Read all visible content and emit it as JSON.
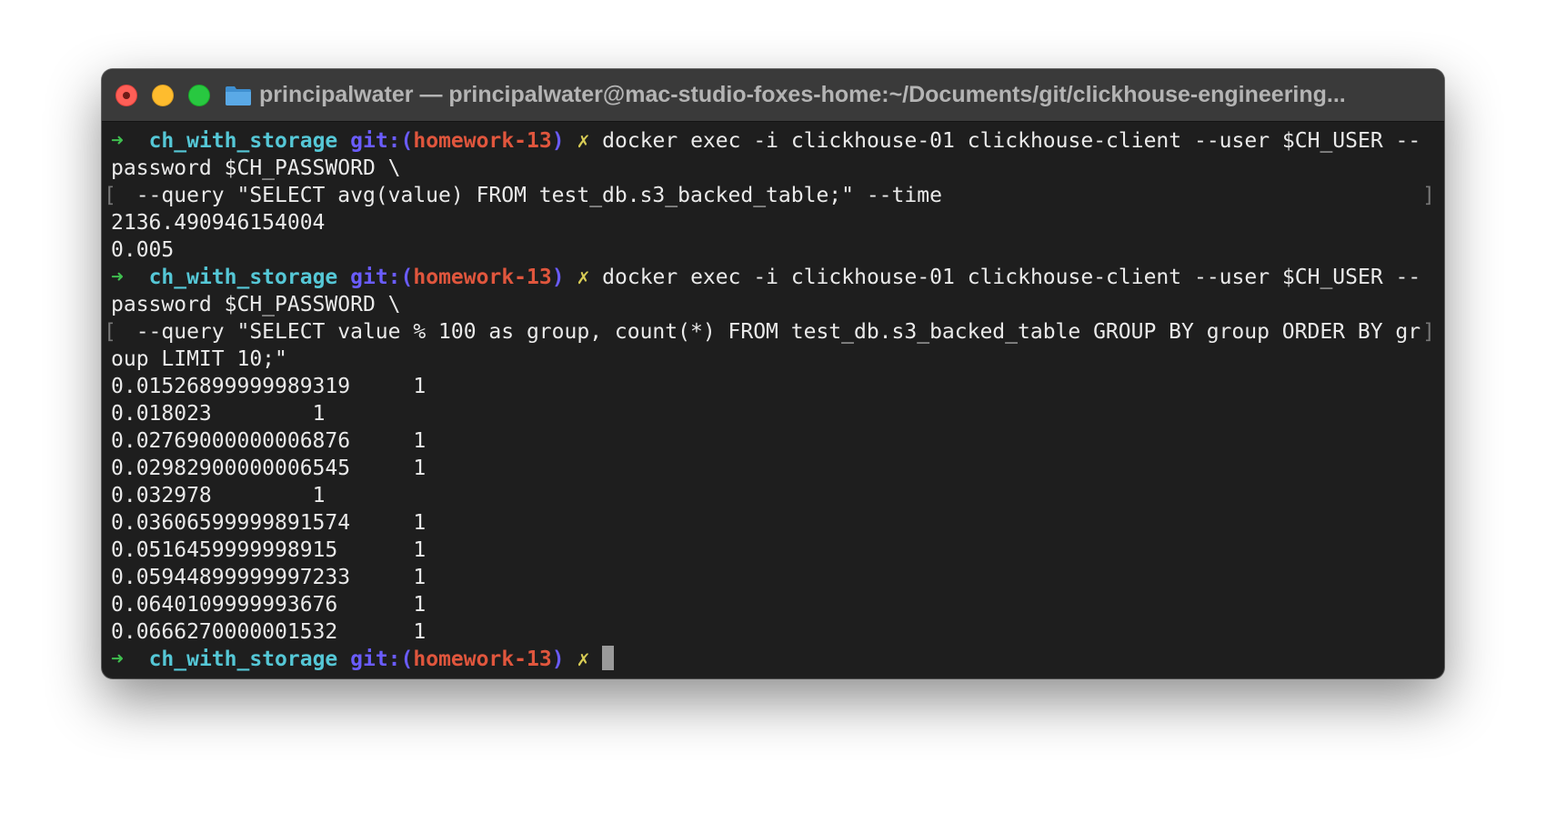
{
  "window": {
    "title": "principalwater — principalwater@mac-studio-foxes-home:~/Documents/git/clickhouse-engineering..."
  },
  "prompt": {
    "arrow": "➜",
    "dir": "ch_with_storage",
    "git_prefix": "git:(",
    "branch": "homework-13",
    "git_suffix": ")",
    "dirty": "✗"
  },
  "commands": [
    {
      "line1": "docker exec -i clickhouse-01 clickhouse-client --user $CH_USER --",
      "line2": "password $CH_PASSWORD \\",
      "line3": "  --query \"SELECT avg(value) FROM test_db.s3_backed_table;\" --time",
      "line4": null,
      "output": [
        "2136.490946154004",
        "0.005"
      ]
    },
    {
      "line1": "docker exec -i clickhouse-01 clickhouse-client --user $CH_USER --",
      "line2": "password $CH_PASSWORD \\",
      "line3": "  --query \"SELECT value % 100 as group, count(*) FROM test_db.s3_backed_table GROUP BY group ORDER BY gr",
      "line4": "oup LIMIT 10;\"",
      "output_rows": [
        {
          "value": "0.01526899999989319",
          "count": "1"
        },
        {
          "value": "0.018023",
          "count": "1"
        },
        {
          "value": "0.02769000000006876",
          "count": "1"
        },
        {
          "value": "0.02982900000006545",
          "count": "1"
        },
        {
          "value": "0.032978",
          "count": "1"
        },
        {
          "value": "0.03606599999891574",
          "count": "1"
        },
        {
          "value": "0.0516459999998915",
          "count": "1"
        },
        {
          "value": "0.05944899999997233",
          "count": "1"
        },
        {
          "value": "0.0640109999993676",
          "count": "1"
        },
        {
          "value": "0.0666270000001532",
          "count": "1"
        }
      ]
    }
  ],
  "colors": {
    "arrow": "#3fbf4f",
    "dir": "#55c7d6",
    "git": "#6a5cff",
    "branch": "#e0563d",
    "dirty": "#d8cc55",
    "background": "#1e1e1e"
  }
}
